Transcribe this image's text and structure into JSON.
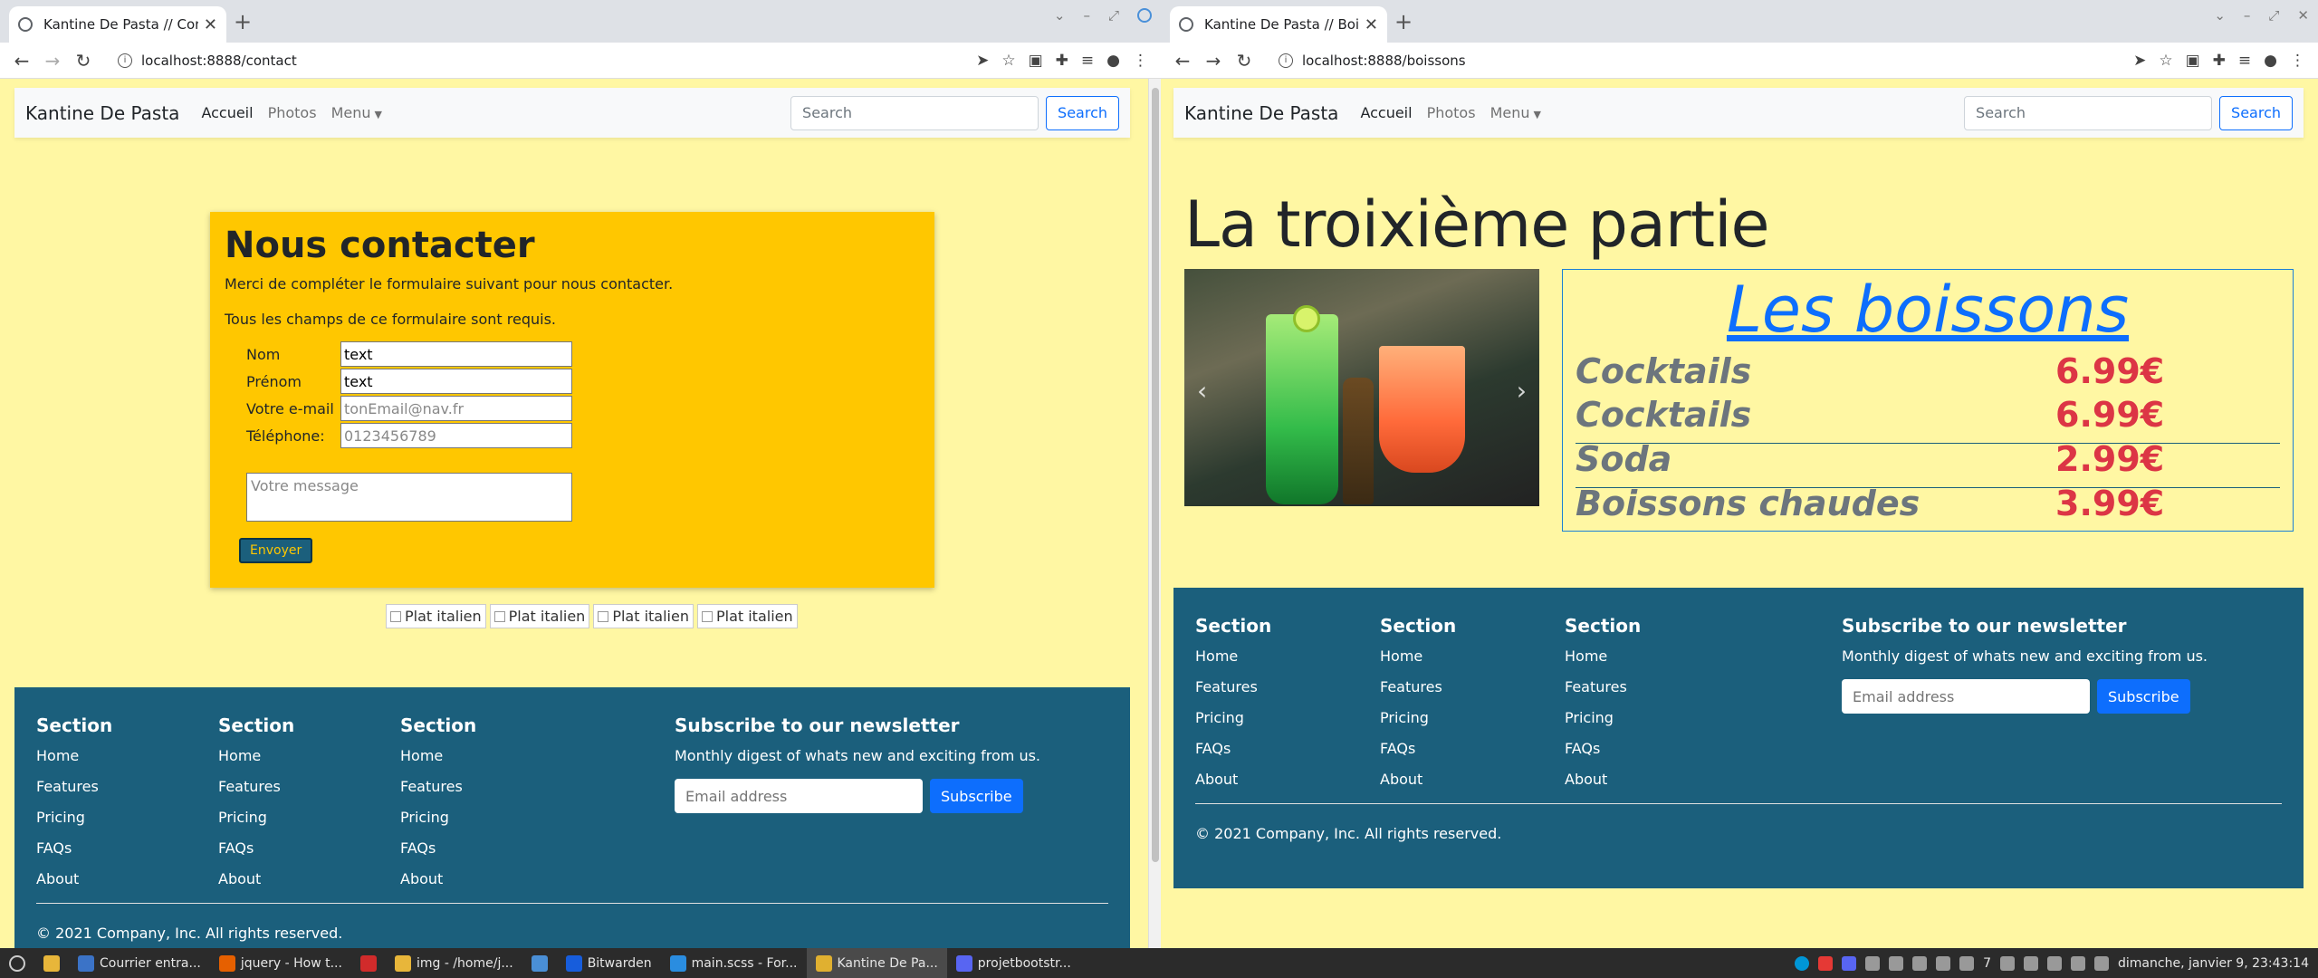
{
  "left_window": {
    "tab_title": "Kantine De Pasta // Contact",
    "url": "localhost:8888/contact",
    "navbar": {
      "brand": "Kantine De Pasta",
      "links": [
        "Accueil",
        "Photos",
        "Menu"
      ],
      "search_placeholder": "Search",
      "search_button": "Search"
    },
    "contact": {
      "title": "Nous contacter",
      "intro": "Merci de compléter le formulaire suivant pour nous contacter.",
      "required_note": "Tous les champs de ce formulaire sont requis.",
      "fields": [
        {
          "label": "Nom",
          "value": "text",
          "placeholder": ""
        },
        {
          "label": "Prénom",
          "value": "text",
          "placeholder": ""
        },
        {
          "label": "Votre e-mail",
          "value": "",
          "placeholder": "tonEmail@nav.fr"
        },
        {
          "label": "Téléphone:",
          "value": "",
          "placeholder": "0123456789"
        }
      ],
      "message_placeholder": "Votre message",
      "send_button": "Envoyer"
    },
    "images_alt": [
      "Plat italien",
      "Plat italien",
      "Plat italien",
      "Plat italien"
    ]
  },
  "right_window": {
    "tab_title": "Kantine De Pasta // Boissons",
    "url": "localhost:8888/boissons",
    "navbar": {
      "brand": "Kantine De Pasta",
      "links": [
        "Accueil",
        "Photos",
        "Menu"
      ],
      "search_placeholder": "Search",
      "search_button": "Search"
    },
    "page_title": "La troixième partie",
    "drinks": {
      "heading": "Les boissons",
      "items": [
        {
          "name": "Cocktails",
          "price": "6.99€"
        },
        {
          "name": "Cocktails",
          "price": "6.99€"
        },
        {
          "name": "Soda",
          "price": "2.99€"
        },
        {
          "name": "Boissons chaudes",
          "price": "3.99€"
        }
      ]
    }
  },
  "footer": {
    "sections": [
      {
        "title": "Section",
        "links": [
          "Home",
          "Features",
          "Pricing",
          "FAQs",
          "About"
        ]
      },
      {
        "title": "Section",
        "links": [
          "Home",
          "Features",
          "Pricing",
          "FAQs",
          "About"
        ]
      },
      {
        "title": "Section",
        "links": [
          "Home",
          "Features",
          "Pricing",
          "FAQs",
          "About"
        ]
      }
    ],
    "newsletter": {
      "title": "Subscribe to our newsletter",
      "text": "Monthly digest of whats new and exciting from us.",
      "placeholder": "Email address",
      "button": "Subscribe"
    },
    "copyright": "© 2021 Company, Inc. All rights reserved."
  },
  "taskbar": {
    "items": [
      {
        "label": "Courrier entra...",
        "icon": "mail-icon",
        "color": "#3b73c7"
      },
      {
        "label": "jquery - How t...",
        "icon": "firefox-icon",
        "color": "#e66000"
      },
      {
        "label": "",
        "icon": "app-red-icon",
        "color": "#d12b2b"
      },
      {
        "label": "img - /home/j...",
        "icon": "folder-icon",
        "color": "#e8b63a"
      },
      {
        "label": "",
        "icon": "screenshot-icon",
        "color": "#4a8fd6"
      },
      {
        "label": "Bitwarden",
        "icon": "bitwarden-icon",
        "color": "#175ddc"
      },
      {
        "label": "main.scss - For...",
        "icon": "vscode-icon",
        "color": "#2a8de0"
      },
      {
        "label": "Kantine De Pa...",
        "icon": "chrome-icon",
        "color": "#e0b030"
      },
      {
        "label": "projetbootstr...",
        "icon": "discord-icon",
        "color": "#5865f2"
      }
    ],
    "active_index": 7,
    "clock": "dimanche, janvier  9, 23:43:14",
    "workspace_count": "7"
  },
  "accent_colors": {
    "page_bg": "#fff7a3",
    "footer_bg": "#1b5f7c",
    "contact_bg": "#ffc700",
    "price_color": "#dc3545",
    "link_blue": "#0d6efd"
  }
}
